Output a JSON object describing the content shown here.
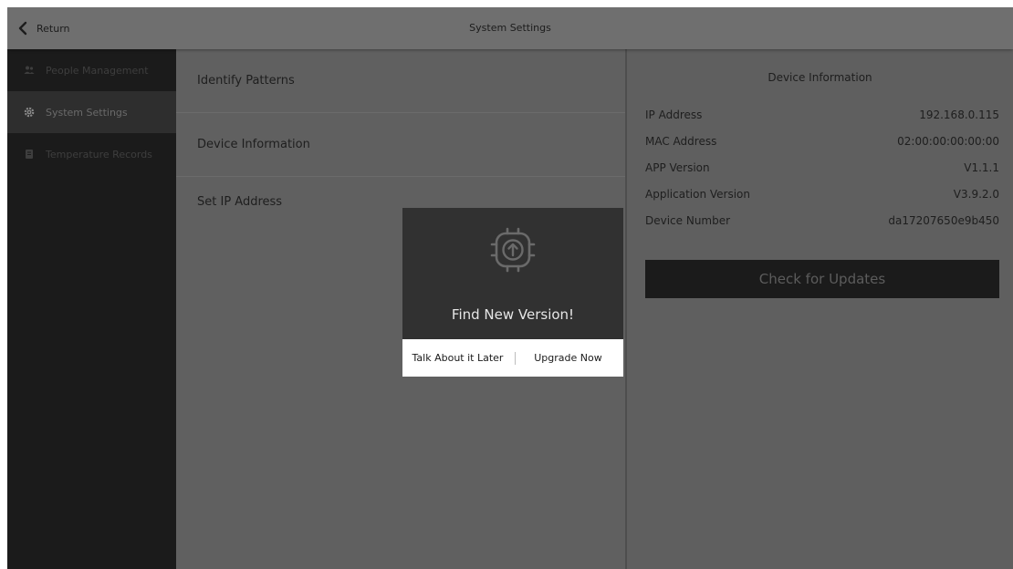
{
  "header": {
    "return_label": "Return",
    "title": "System Settings",
    "return_icon": "chevron-left-icon"
  },
  "sidebar": {
    "items": [
      {
        "label": "People Management",
        "icon": "people-icon",
        "active": false
      },
      {
        "label": "System Settings",
        "icon": "gear-icon",
        "active": true
      },
      {
        "label": "Temperature Records",
        "icon": "document-icon",
        "active": false
      }
    ]
  },
  "settings_list": {
    "items": [
      {
        "label": "Identify Patterns"
      },
      {
        "label": "Device Information"
      },
      {
        "label": "Set IP Address"
      }
    ]
  },
  "device_info": {
    "title": "Device Information",
    "rows": [
      {
        "label": "IP Address",
        "value": "192.168.0.115"
      },
      {
        "label": "MAC Address",
        "value": "02:00:00:00:00:00"
      },
      {
        "label": "APP Version",
        "value": "V1.1.1"
      },
      {
        "label": "Application Version",
        "value": "V3.9.2.0"
      },
      {
        "label": "Device Number",
        "value": "da17207650e9b450"
      }
    ],
    "check_button_label": "Check for Updates"
  },
  "dialog": {
    "icon": "upgrade-chip-icon",
    "title": "Find New Version!",
    "later_label": "Talk About it Later",
    "upgrade_label": "Upgrade Now"
  },
  "colors": {
    "sidebar_bg": "#1b1b1b",
    "overlay_bg": "#5f5f5f",
    "dialog_bg": "#313131",
    "button_dark": "#1b1b1b"
  }
}
